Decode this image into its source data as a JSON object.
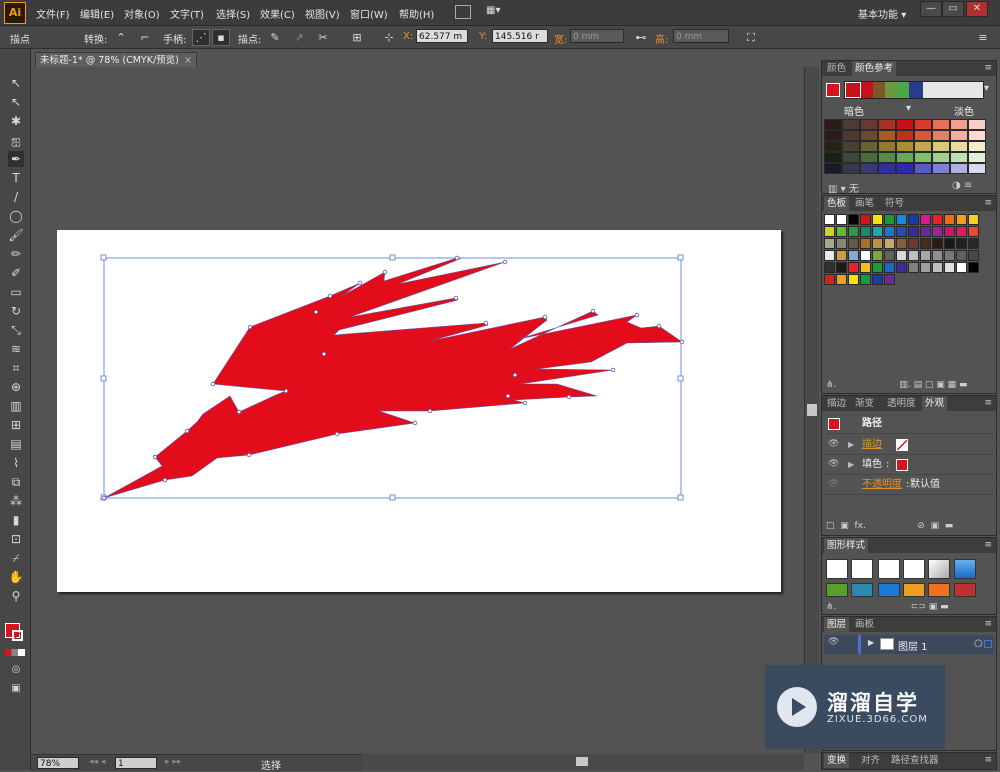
{
  "app": {
    "logo_text": "Ai",
    "workspace": "基本功能",
    "workspace_caret": "▾"
  },
  "menu": [
    "文件(F)",
    "编辑(E)",
    "对象(O)",
    "文字(T)",
    "选择(S)",
    "效果(C)",
    "视图(V)",
    "窗口(W)",
    "帮助(H)"
  ],
  "window_buttons": [
    "—",
    "▭",
    "✕"
  ],
  "control_bar": {
    "selection": "描点",
    "convert_label": "转换:",
    "handles_label": "手柄:",
    "anchor_label": "描点:",
    "x_label": "X:",
    "x_value": "62.577 m",
    "y_label": "Y:",
    "y_value": "145.516 r",
    "w_label": "宽:",
    "w_value": "0 mm",
    "h_label": "高:",
    "h_value": "0 mm"
  },
  "document": {
    "tab_title": "未标题-1* @ 78% (CMYK/预览)",
    "close": "×"
  },
  "status": {
    "zoom": "78%",
    "artboard": "1",
    "tool": "选择"
  },
  "color_panel": {
    "tabs": [
      "颜色",
      "颜色参考"
    ],
    "shade_dark": "暗色",
    "shade_light": "淡色",
    "none_label": "无",
    "accent": "#d7131c"
  },
  "swatches_panel": {
    "tabs": [
      "色板",
      "画笔",
      "符号"
    ]
  },
  "appearance_panel": {
    "tabs": [
      "描边",
      "渐变",
      "透明度",
      "外观"
    ],
    "path_label": "路径",
    "stroke_label": "描边",
    "fill_label": "填色",
    "opacity_label": "不透明度",
    "opacity_value": "默认值",
    "fx": "fx."
  },
  "graphic_styles_panel": {
    "tabs": [
      "图形样式"
    ]
  },
  "layers_panel": {
    "tabs": [
      "图层",
      "画板"
    ],
    "layer_name": "图层 1"
  },
  "bottom_tabs": [
    "变换",
    "对齐",
    "路径查找器"
  ],
  "watermark": {
    "title": "溜溜自学",
    "url": "ZIXUE.3D66.COM"
  },
  "icons": [
    "selection-tool-icon",
    "direct-selection-icon",
    "magic-wand-icon",
    "lasso-icon",
    "pen-tool-icon",
    "type-tool-icon",
    "line-tool-icon",
    "ellipse-tool-icon",
    "paintbrush-icon",
    "pencil-icon",
    "blob-brush-icon",
    "eraser-icon",
    "rotate-icon",
    "scale-icon",
    "warp-icon",
    "free-transform-icon",
    "shape-builder-icon",
    "perspective-grid-icon",
    "mesh-icon",
    "gradient-icon",
    "eyedropper-icon",
    "blend-icon",
    "symbol-sprayer-icon",
    "column-graph-icon",
    "artboard-tool-icon",
    "slice-icon",
    "hand-icon",
    "zoom-icon"
  ]
}
